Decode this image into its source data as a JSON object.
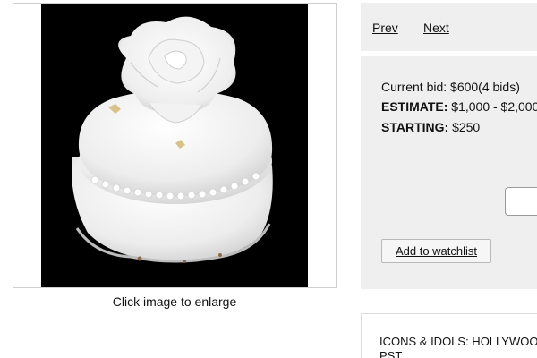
{
  "image": {
    "icon": "cake-photo",
    "caption": "Click image to enlarge"
  },
  "nav": {
    "prev_label": "Prev",
    "next_label": "Next"
  },
  "bid": {
    "current_bid": "Current bid: $600(4 bids)",
    "estimate_label": "ESTIMATE:",
    "estimate_value": " $1,000 - $2,000",
    "starting_label": "STARTING:",
    "starting_value": " $250"
  },
  "actions": {
    "watchlist_label": "Add to watchlist"
  },
  "lot": {
    "title": "ICONS & IDOLS: HOLLYWOOD PST"
  },
  "colors": {
    "panel_bg": "#efefef",
    "image_bg": "#000000"
  }
}
